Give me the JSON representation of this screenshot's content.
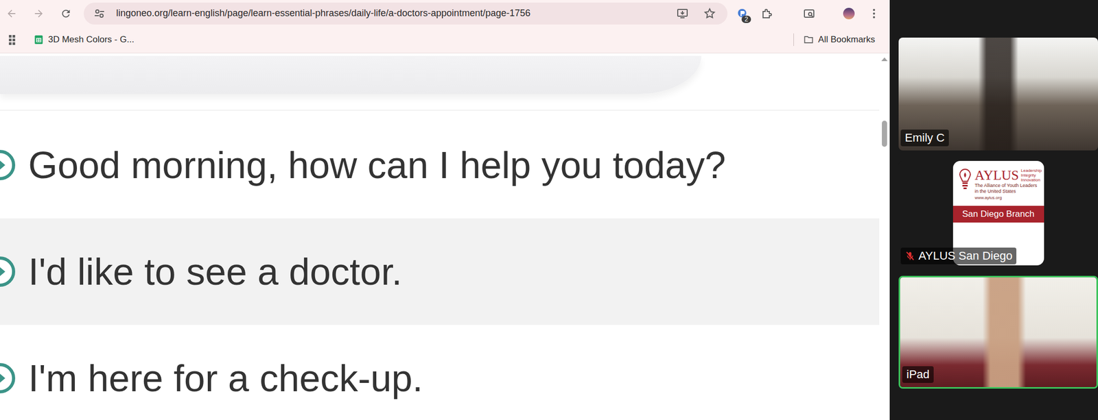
{
  "browser": {
    "url": "lingoneo.org/learn-english/page/learn-essential-phrases/daily-life/a-doctors-appointment/page-1756",
    "extension_badge": "2",
    "bookmarks": [
      {
        "label": "3D Mesh Colors - G..."
      }
    ],
    "all_bookmarks": "All Bookmarks"
  },
  "phrases": [
    {
      "text": "Good morning, how can I help you today?",
      "highlighted": false
    },
    {
      "text": "I'd like to see a doctor.",
      "highlighted": true
    },
    {
      "text": "I'm here for a check-up.",
      "highlighted": false
    }
  ],
  "participants": [
    {
      "name": "Emily C",
      "kind": "video",
      "muted": false,
      "speaking": false
    },
    {
      "name": "AYLUS San Diego",
      "kind": "logo",
      "muted": true,
      "speaking": false
    },
    {
      "name": "iPad",
      "kind": "video",
      "muted": false,
      "speaking": true
    }
  ],
  "logo": {
    "title": "AYLUS",
    "tagline": "Leadership Integrity Innovation",
    "subtitle": "The Alliance of Youth Leaders in the United States",
    "url": "www.aylus.org",
    "band": "San Diego Branch"
  }
}
